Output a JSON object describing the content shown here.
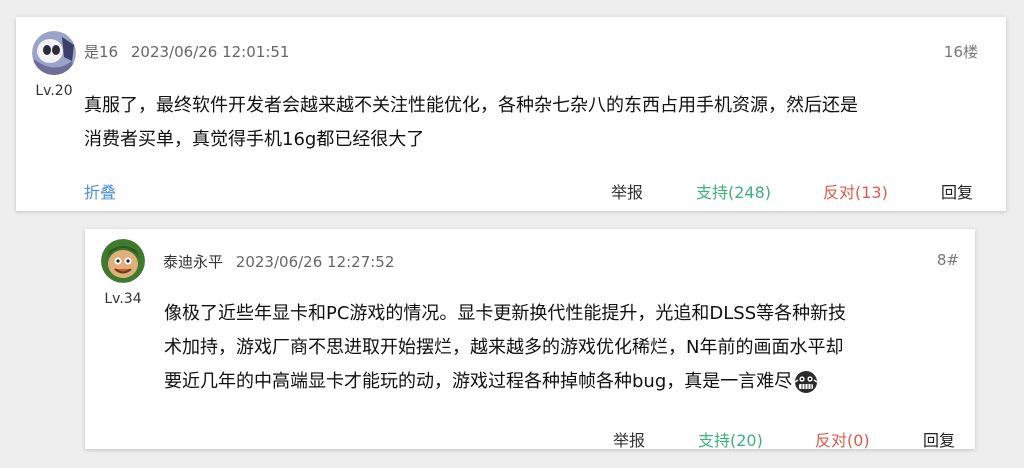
{
  "comment": {
    "username": "是16",
    "timestamp": "2023/06/26 12:01:51",
    "floor": "16楼",
    "level": "Lv.20",
    "content_line1": "真服了，最终软件开发者会越来越不关注性能优化，各种杂七杂八的东西占用手机资源，然后还是",
    "content_line2": "消费者买单，真觉得手机16g都已经很大了",
    "actions": {
      "fold": "折叠",
      "report": "举报",
      "support": "支持(248)",
      "oppose": "反对(13)",
      "reply": "回复"
    }
  },
  "reply": {
    "username": "泰迪永平",
    "timestamp": "2023/06/26 12:27:52",
    "floor": "8#",
    "level": "Lv.34",
    "content_line1": "像极了近些年显卡和PC游戏的情况。显卡更新换代性能提升，光追和DLSS等各种新技",
    "content_line2": "术加持，游戏厂商不思进取开始摆烂，越来越多的游戏优化稀烂，N年前的画面水平却",
    "content_line3": "要近几年的中高端显卡才能玩的动，游戏过程各种掉帧各种bug，真是一言难尽",
    "emoji_icon": "grimace-emoji-icon",
    "actions": {
      "report": "举报",
      "support": "支持(20)",
      "oppose": "反对(0)",
      "reply": "回复"
    }
  },
  "colors": {
    "support": "#3cb37a",
    "oppose": "#e05a4a",
    "fold": "#4a90d9"
  }
}
